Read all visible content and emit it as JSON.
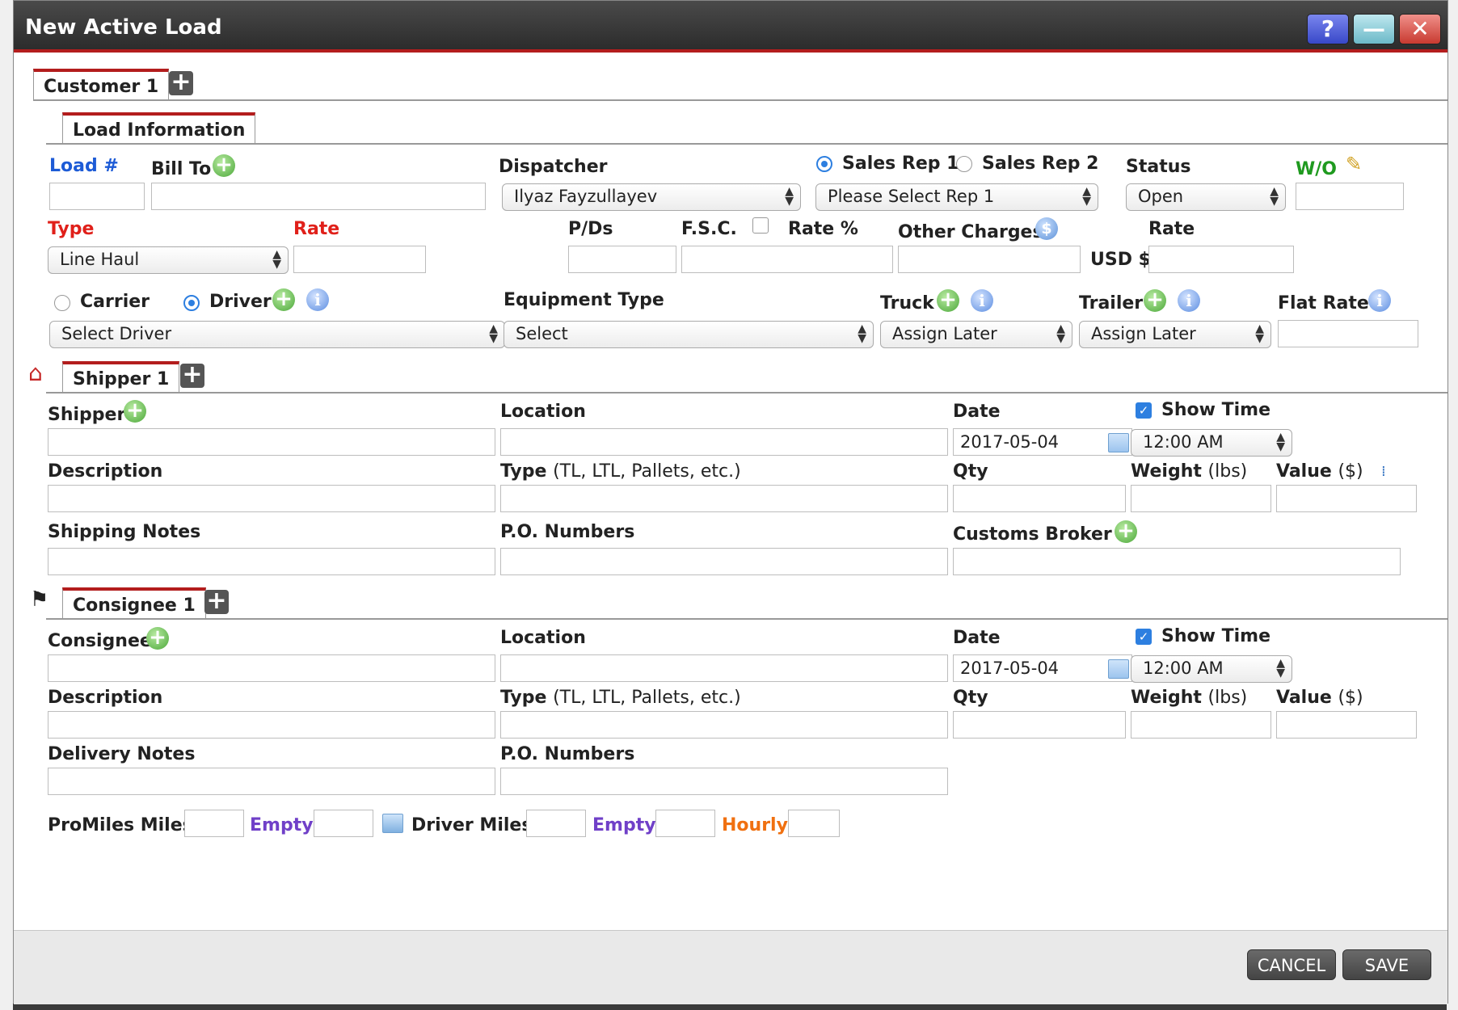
{
  "dialog": {
    "title": "New Active Load",
    "help_glyph": "?",
    "minimize_glyph": "—",
    "close_glyph": "✕"
  },
  "customer_tab": {
    "label": "Customer 1"
  },
  "load_info": {
    "tab_label": "Load Information",
    "load_no_label": "Load #",
    "bill_to_label": "Bill To",
    "dispatcher_label": "Dispatcher",
    "dispatcher_value": "Ilyaz Fayzullayev",
    "sales_rep_1_label": "Sales Rep 1",
    "sales_rep_2_label": "Sales Rep 2",
    "sales_rep_value": "Please Select Rep 1",
    "status_label": "Status",
    "status_value": "Open",
    "wo_label": "W/O",
    "type_label": "Type",
    "type_value": "Line Haul",
    "rate_label": "Rate",
    "pds_label": "P/Ds",
    "fsc_label": "F.S.C.",
    "rate_pct_label": "Rate %",
    "other_charges_label": "Other Charges",
    "rate2_label": "Rate",
    "usd_label": "USD $",
    "carrier_label": "Carrier",
    "driver_label": "Driver",
    "driver_value": "Select Driver",
    "equipment_label": "Equipment Type",
    "equipment_value": "Select",
    "truck_label": "Truck",
    "truck_value": "Assign Later",
    "trailer_label": "Trailer",
    "trailer_value": "Assign Later",
    "flat_rate_label": "Flat Rate"
  },
  "shipper": {
    "tab_label": "Shipper 1",
    "shipper_label": "Shipper",
    "location_label": "Location",
    "date_label": "Date",
    "date_value": "2017-05-04",
    "show_time_label": "Show Time",
    "time_value": "12:00 AM",
    "description_label": "Description",
    "type_label": "Type",
    "type_hint": "(TL, LTL, Pallets, etc.)",
    "qty_label": "Qty",
    "weight_label": "Weight",
    "weight_unit": "(lbs)",
    "value_label": "Value",
    "value_unit": "($)",
    "notes_label": "Shipping Notes",
    "po_label": "P.O. Numbers",
    "customs_label": "Customs Broker"
  },
  "consignee": {
    "tab_label": "Consignee 1",
    "consignee_label": "Consignee",
    "location_label": "Location",
    "date_label": "Date",
    "date_value": "2017-05-04",
    "show_time_label": "Show Time",
    "time_value": "12:00 AM",
    "description_label": "Description",
    "type_label": "Type",
    "type_hint": "(TL, LTL, Pallets, etc.)",
    "qty_label": "Qty",
    "weight_label": "Weight",
    "weight_unit": "(lbs)",
    "value_label": "Value",
    "value_unit": "($)",
    "notes_label": "Delivery Notes",
    "po_label": "P.O. Numbers"
  },
  "miles": {
    "promiles_label": "ProMiles Miles",
    "empty1_label": "Empty",
    "driver_miles_label": "Driver Miles",
    "empty2_label": "Empty",
    "hourly_label": "Hourly"
  },
  "footer": {
    "cancel_label": "CANCEL",
    "save_label": "SAVE"
  }
}
